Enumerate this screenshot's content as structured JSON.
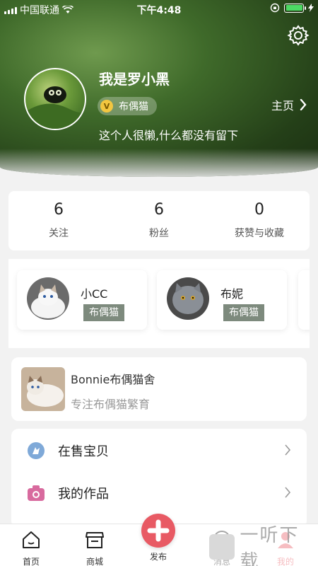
{
  "status_bar": {
    "carrier": "中国联通",
    "time": "下午4:48"
  },
  "profile": {
    "username": "我是罗小黑",
    "badge_letter": "V",
    "breed": "布偶猫",
    "homepage_label": "主页",
    "bio": "这个人很懒,什么都没有留下"
  },
  "stats": [
    {
      "value": "6",
      "label": "关注"
    },
    {
      "value": "6",
      "label": "粉丝"
    },
    {
      "value": "0",
      "label": "获赞与收藏"
    }
  ],
  "cats": [
    {
      "name": "小CC",
      "tag": "布偶猫"
    },
    {
      "name": "布妮",
      "tag": "布偶猫"
    }
  ],
  "cattery": {
    "name": "Bonnie布偶猫舍",
    "description": "专注布偶猫繁育"
  },
  "menu": [
    {
      "label": "在售宝贝",
      "icon": "seller-icon"
    },
    {
      "label": "我的作品",
      "icon": "camera-icon"
    }
  ],
  "tabbar": {
    "home": "首页",
    "mall": "商城",
    "publish": "发布",
    "messages": "消息",
    "mine": "我的"
  },
  "watermark": "一听下载",
  "colors": {
    "accent": "#e85a64",
    "tag_bg": "#7d8a7d",
    "badge": "#f2c640"
  }
}
